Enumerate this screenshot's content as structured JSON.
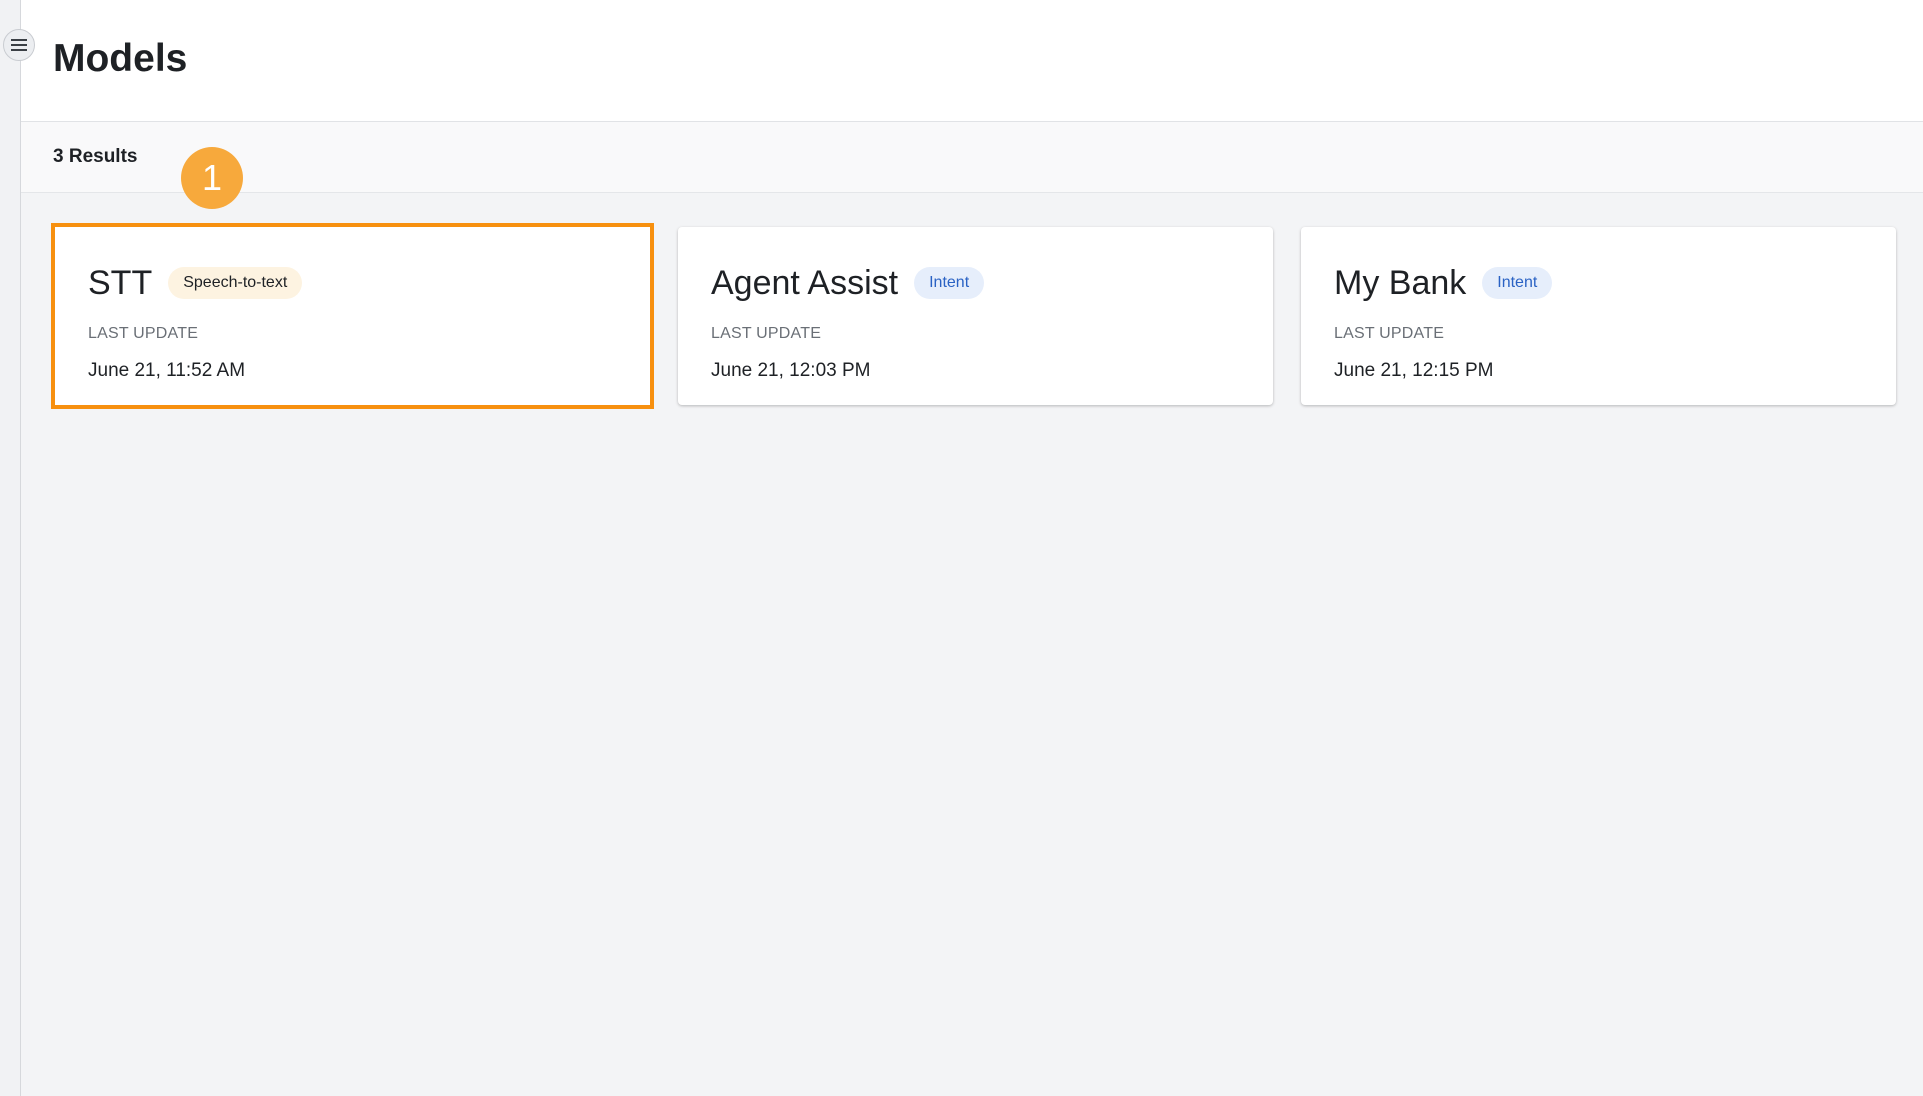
{
  "header": {
    "title": "Models"
  },
  "results": {
    "count_label": "3 Results"
  },
  "step_marker": {
    "label": "1"
  },
  "cards": [
    {
      "title": "STT",
      "badge": "Speech-to-text",
      "last_update_label": "LAST UPDATE",
      "last_update": "June 21, 11:52 AM"
    },
    {
      "title": "Agent Assist",
      "badge": "Intent",
      "last_update_label": "LAST UPDATE",
      "last_update": "June 21, 12:03 PM"
    },
    {
      "title": "My Bank",
      "badge": "Intent",
      "last_update_label": "LAST UPDATE",
      "last_update": "June 21, 12:15 PM"
    }
  ],
  "colors": {
    "highlight": "#f7900f",
    "step_marker": "#f7a93c",
    "intent_badge_text": "#2a62c4",
    "intent_badge_bg": "#e6eefb",
    "stt_badge_bg": "#fdf3e1"
  },
  "icons": {
    "menu": "hamburger-menu-icon"
  }
}
